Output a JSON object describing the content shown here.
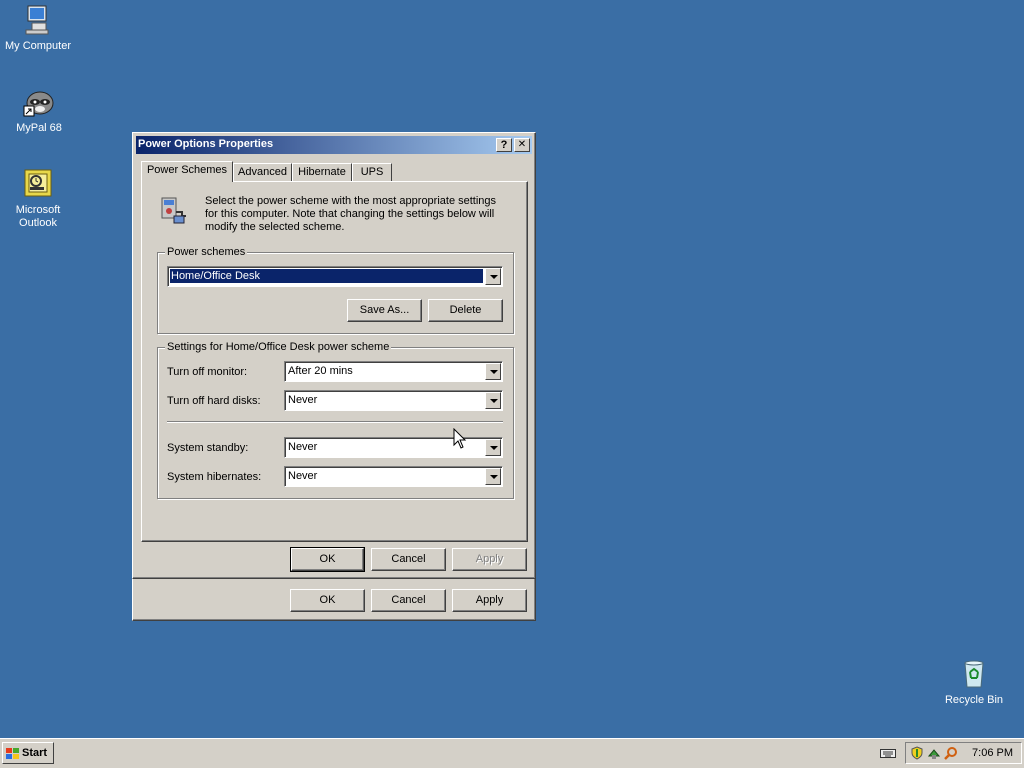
{
  "desktop": {
    "icons": [
      {
        "label": "My Computer"
      },
      {
        "label": "MyPal 68"
      },
      {
        "label": "Microsoft Outlook"
      },
      {
        "label": "Recycle Bin"
      }
    ]
  },
  "dialog": {
    "title": "Power Options Properties",
    "help_label": "?",
    "close_label": "✕",
    "tabs": [
      {
        "label": "Power Schemes",
        "active": true
      },
      {
        "label": "Advanced"
      },
      {
        "label": "Hibernate"
      },
      {
        "label": "UPS"
      }
    ],
    "intro_text": "Select the power scheme with the most appropriate settings for this computer. Note that changing the settings below will modify the selected scheme.",
    "power_schemes": {
      "legend": "Power schemes",
      "selected": "Home/Office Desk",
      "save_as_label": "Save As...",
      "delete_label": "Delete"
    },
    "settings": {
      "legend": "Settings for Home/Office Desk power scheme",
      "rows": [
        {
          "label": "Turn off monitor:",
          "value": "After 20 mins"
        },
        {
          "label": "Turn off hard disks:",
          "value": "Never"
        },
        {
          "label": "System standby:",
          "value": "Never"
        },
        {
          "label": "System hibernates:",
          "value": "Never"
        }
      ]
    },
    "buttons": {
      "ok": "OK",
      "cancel": "Cancel",
      "apply": "Apply"
    }
  },
  "back_dialog": {
    "buttons": {
      "ok": "OK",
      "cancel": "Cancel",
      "apply": "Apply"
    }
  },
  "taskbar": {
    "start_label": "Start",
    "clock": "7:06 PM"
  }
}
